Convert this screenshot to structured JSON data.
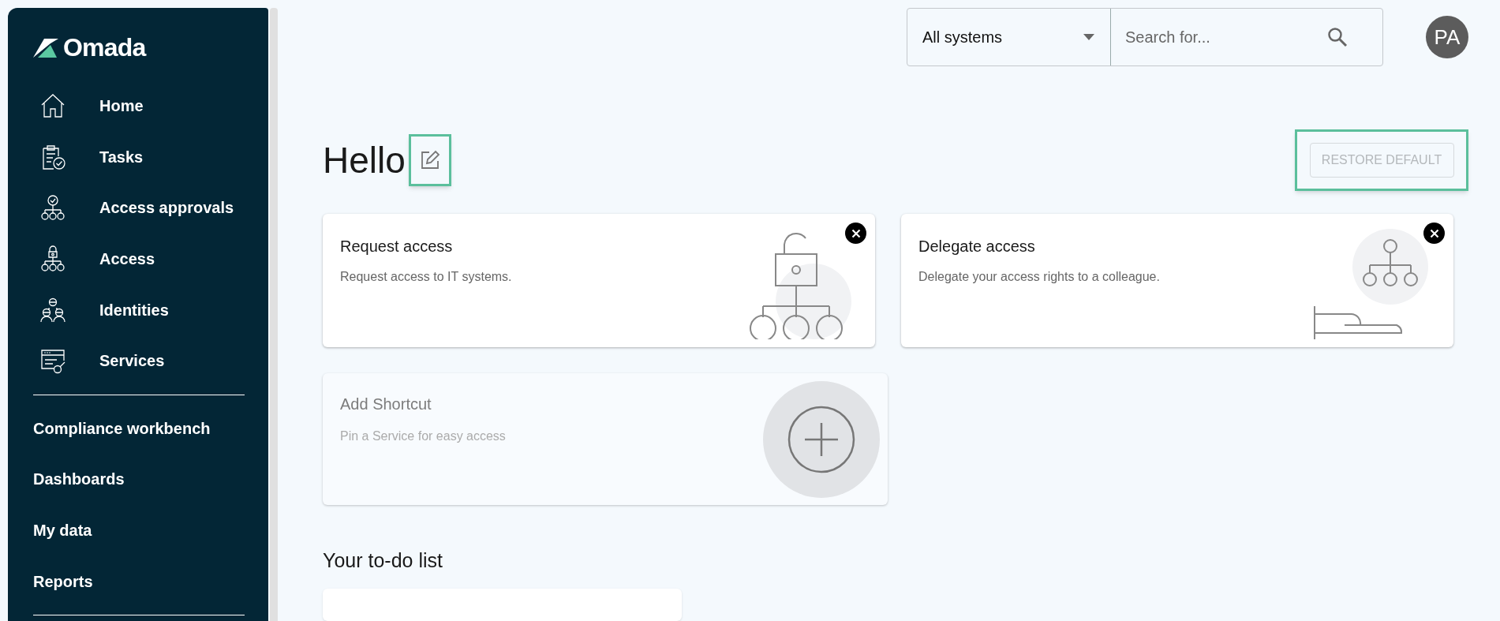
{
  "sidebar": {
    "logo": "Omada",
    "primary_items": [
      {
        "label": "Home"
      },
      {
        "label": "Tasks"
      },
      {
        "label": "Access approvals"
      },
      {
        "label": "Access"
      },
      {
        "label": "Identities"
      },
      {
        "label": "Services"
      }
    ],
    "secondary_items": [
      {
        "label": "Compliance workbench"
      },
      {
        "label": "Dashboards"
      },
      {
        "label": "My data"
      },
      {
        "label": "Reports"
      }
    ]
  },
  "header": {
    "system_select": {
      "value": "All systems"
    },
    "search": {
      "placeholder": "Search for..."
    },
    "avatar": "PA"
  },
  "greeting": {
    "title": "Hello",
    "restore_button": "RESTORE DEFAULT"
  },
  "shortcuts": [
    {
      "kind": "shortcut",
      "title": "Request access",
      "description": "Request access to IT systems."
    },
    {
      "kind": "shortcut",
      "title": "Delegate access",
      "description": "Delegate your access rights to a colleague."
    },
    {
      "kind": "add",
      "title": "Add Shortcut",
      "description": "Pin a Service for easy access"
    }
  ],
  "todo": {
    "title": "Your to-do list"
  }
}
